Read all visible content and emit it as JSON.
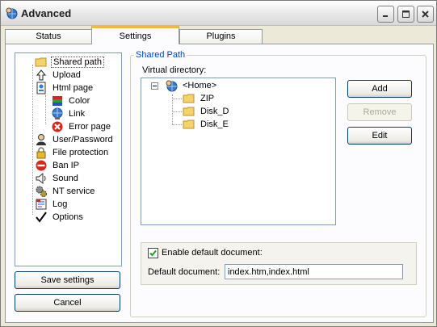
{
  "window": {
    "title": "Advanced"
  },
  "tabs": [
    {
      "label": "Status"
    },
    {
      "label": "Settings",
      "active": true
    },
    {
      "label": "Plugins"
    }
  ],
  "settings_tree": {
    "items": [
      {
        "label": "Shared path",
        "icon": "folder-icon",
        "selected": true
      },
      {
        "label": "Upload",
        "icon": "upload-arrow-icon"
      },
      {
        "label": "Html page",
        "icon": "html-page-icon"
      },
      {
        "label": "Color",
        "icon": "color-palette-icon"
      },
      {
        "label": "Link",
        "icon": "link-globe-icon"
      },
      {
        "label": "Error page",
        "icon": "error-icon"
      },
      {
        "label": "User/Password",
        "icon": "user-icon"
      },
      {
        "label": "File protection",
        "icon": "lock-icon"
      },
      {
        "label": "Ban IP",
        "icon": "ban-icon"
      },
      {
        "label": "Sound",
        "icon": "speaker-icon"
      },
      {
        "label": "NT service",
        "icon": "gears-icon"
      },
      {
        "label": "Log",
        "icon": "log-icon"
      },
      {
        "label": "Options",
        "icon": "checkmark-icon"
      }
    ]
  },
  "buttons": {
    "save_settings": "Save settings",
    "cancel": "Cancel",
    "add": "Add",
    "remove": "Remove",
    "edit": "Edit"
  },
  "shared_path": {
    "group_title": "Shared Path",
    "virtual_directory_label": "Virtual directory:",
    "tree": {
      "root": "<Home>",
      "children": [
        "ZIP",
        "Disk_D",
        "Disk_E"
      ]
    },
    "enable_default_label": "Enable default document:",
    "enable_default_checked": true,
    "default_document_label": "Default document:",
    "default_document_value": "index.htm,index.html"
  },
  "colors": {
    "accent_tab": "#f7b545",
    "group_title": "#0046d5",
    "folder": "#f3d36a"
  }
}
